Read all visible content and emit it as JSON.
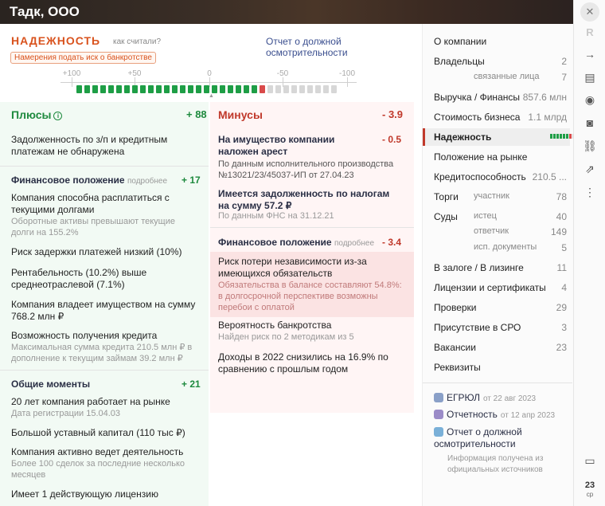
{
  "company": {
    "name": "Тадк, ООО"
  },
  "header": {
    "title": "НАДЕЖНОСТЬ",
    "how_calc": "как считали?",
    "link": "Отчет о должной осмотрительности",
    "badge": "Намерения подать иск о банкротстве"
  },
  "scale": {
    "labels": [
      "+100",
      "+50",
      "0",
      "-50",
      "-100"
    ],
    "green_segments": 23,
    "red_segments": 1,
    "colors": {
      "green": "#1e9e46",
      "red": "#d94a4a",
      "empty": "#d7d7d7"
    }
  },
  "plus": {
    "title": "Плюсы",
    "total": "+ 88",
    "intro": "Задолженность по з/п и кредитным платежам не обнаружена",
    "sections": [
      {
        "title": "Финансовое положение",
        "more": "подробнее",
        "score": "+ 17",
        "items": [
          {
            "text": "Компания способна расплатиться с текущими долгами",
            "sub": "Оборотные активы превышают текущие долги на 155.2%"
          },
          {
            "text": "Риск задержки платежей низкий (10%)",
            "sub": ""
          },
          {
            "text": "Рентабельность (10.2%) выше среднеотраслевой (7.1%)",
            "sub": ""
          },
          {
            "text": "Компания владеет имуществом на сумму 768.2 млн ₽",
            "sub": ""
          },
          {
            "text": "Возможность получения кредита",
            "sub": "Максимальная сумма кредита 210.5 млн ₽ в дополнение к текущим займам 39.2 млн ₽"
          }
        ]
      },
      {
        "title": "Общие моменты",
        "score": "+ 21",
        "items": [
          {
            "text": "20 лет компания работает на рынке",
            "sub": "Дата регистрации 15.04.03"
          },
          {
            "text": "Большой уставный капитал (110 тыс ₽)",
            "sub": ""
          },
          {
            "text": "Компания активно ведет деятельность",
            "sub": "Более 100 сделок за последние несколько месяцев"
          },
          {
            "text": "Имеет 1 действующую лицензию",
            "sub": ""
          }
        ]
      }
    ]
  },
  "minus": {
    "title": "Минусы",
    "total": "- 3.9",
    "items": [
      {
        "text": "На имущество компании наложен арест",
        "score": "- 0.5",
        "sub": "По данным исполнительного производства №13021/23/45037-ИП от 27.04.23"
      },
      {
        "text": "Имеется задолженность по налогам на сумму 57.2 ₽",
        "sub": "По данным ФНС на 31.12.21"
      }
    ],
    "section": {
      "title": "Финансовое положение",
      "more": "подробнее",
      "score": "- 3.4",
      "items": [
        {
          "text": "Риск потери независимости из-за имеющихся обязательств",
          "sub": "Обязательства в балансе составляют 54.8%: в долгосрочной перспективе возможны перебои с оплатой"
        },
        {
          "text": "Вероятность банкротства",
          "sub": "Найден риск по 2 методикам из 5"
        },
        {
          "text": "Доходы в 2022 снизились на 16.9% по сравнению с прошлым годом",
          "sub": ""
        }
      ]
    }
  },
  "menu": {
    "items": [
      {
        "label": "О компании",
        "value": ""
      },
      {
        "label": "Владельцы",
        "value": "2"
      },
      {
        "label": "связанные лица",
        "value": "7"
      },
      {
        "label": "Выручка / Финансы",
        "value": "857.6 млн"
      },
      {
        "label": "Стоимость бизнеса",
        "value": "1.1 млрд"
      },
      {
        "label": "Надежность",
        "value": ""
      },
      {
        "label": "Положение на рынке",
        "value": ""
      },
      {
        "label": "Кредитоспособность",
        "value": "210.5 ..."
      },
      {
        "label": "Торги",
        "sub": "участник",
        "value": "78"
      },
      {
        "label": "Суды",
        "sub": "истец",
        "value": "40"
      },
      {
        "label": "ответчик",
        "value": "149"
      },
      {
        "label": "исп. документы",
        "value": "5"
      },
      {
        "label": "В залоге / В лизинге",
        "value": "11"
      },
      {
        "label": "Лицензии и сертификаты",
        "value": "4"
      },
      {
        "label": "Проверки",
        "value": "29"
      },
      {
        "label": "Присутствие в СРО",
        "value": "3"
      },
      {
        "label": "Вакансии",
        "value": "23"
      },
      {
        "label": "Реквизиты",
        "value": ""
      }
    ],
    "docs": [
      {
        "label": "ЕГРЮЛ",
        "date": "от 22 авг 2023"
      },
      {
        "label": "Отчетность",
        "date": "от 12 апр 2023"
      },
      {
        "label": "Отчет о должной осмотрительности",
        "date": ""
      }
    ],
    "note": "Информация получена из официальных источников"
  },
  "sidebar": {
    "close": "✕",
    "r": "R",
    "bottom_num": "23",
    "bottom_sub": "ср"
  }
}
